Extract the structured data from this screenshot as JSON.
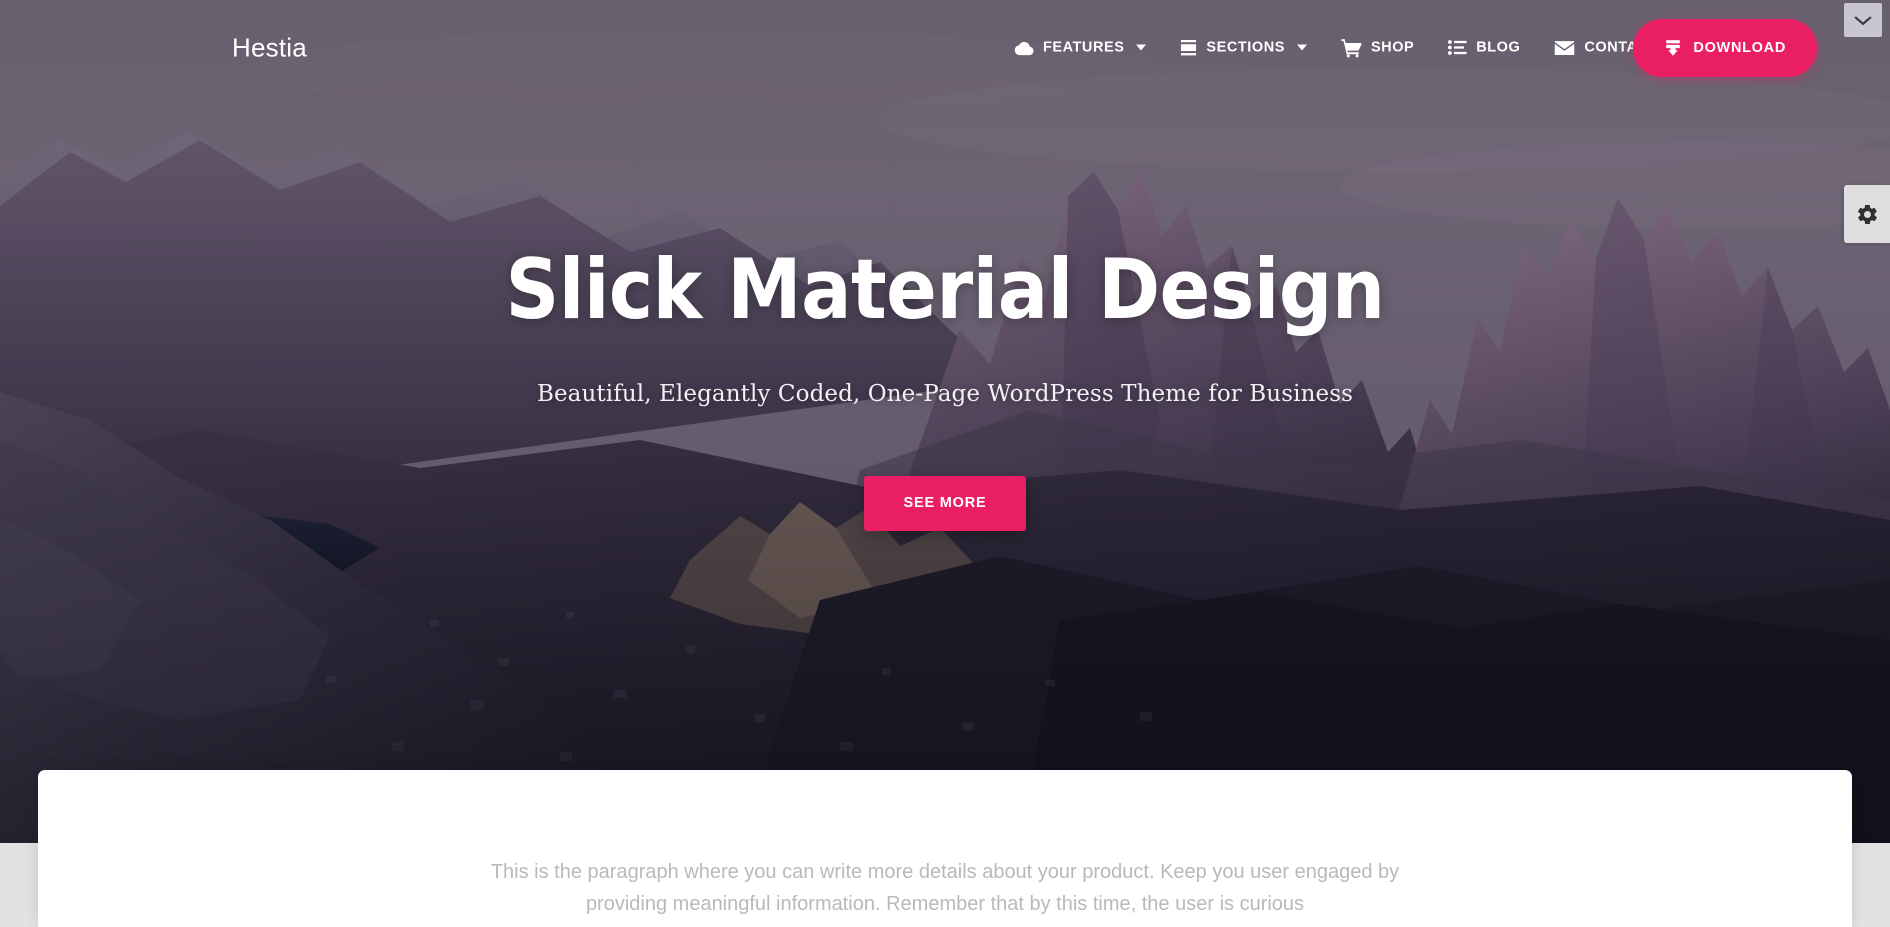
{
  "theme": {
    "accent_color": "#e91e63",
    "text_on_hero": "#ffffff"
  },
  "navbar": {
    "brand": "Hestia",
    "items": [
      {
        "label": "FEATURES",
        "icon": "cloud-icon",
        "has_dropdown": true
      },
      {
        "label": "SECTIONS",
        "icon": "layout-icon",
        "has_dropdown": true
      },
      {
        "label": "SHOP",
        "icon": "shopping-cart-icon",
        "has_dropdown": false
      },
      {
        "label": "BLOG",
        "icon": "list-icon",
        "has_dropdown": false
      },
      {
        "label": "CONTACT",
        "icon": "envelope-icon",
        "has_dropdown": false
      }
    ],
    "download_label": "DOWNLOAD",
    "download_icon": "download-icon"
  },
  "hero": {
    "title": "Slick Material Design",
    "subtitle": "Beautiful, Elegantly Coded, One-Page WordPress Theme for Business",
    "cta_label": "SEE MORE"
  },
  "content": {
    "paragraph": "This is the paragraph where you can write more details about your product. Keep you user engaged by providing meaningful information. Remember that by this time, the user is curious"
  },
  "chrome": {
    "collapse_icon": "chevron-down-icon",
    "settings_icon": "gear-icon"
  }
}
